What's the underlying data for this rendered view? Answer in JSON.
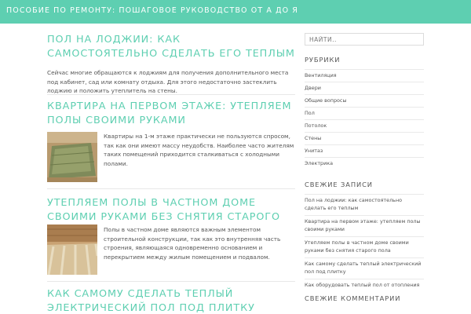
{
  "header": {
    "site_title": "Пособие по ремонту: пошаговое руководство от А до Я"
  },
  "posts": [
    {
      "title": "Пол на лоджии: как самостоятельно сделать его теплым",
      "excerpt": "Сейчас многие обращаются к лоджиям для получения дополнительного места под кабинет, сад или комнату отдыха. Для этого недостаточно застеклить лоджию и положить утеплитель на стены.",
      "has_thumbnail": false
    },
    {
      "title": "Квартира на первом этаже: утепляем полы своими руками",
      "excerpt": "Квартиры на 1-м этаже практически не пользуются спросом, так как они имеют массу неудобств. Наиболее часто жителям таких помещений приходится сталкиваться с холодными полами.",
      "has_thumbnail": true
    },
    {
      "title": "Утепляем полы в частном доме своими руками без снятия старого пола",
      "excerpt": "Полы в частном доме являются важным элементом строительной конструкции, так как это внутренняя часть строения, являющаяся одновременно основанием и перекрытием между жилым помещением и подвалом.",
      "has_thumbnail": true
    },
    {
      "title": "Как самому сделать теплый электрический пол под плитку",
      "excerpt": "",
      "has_thumbnail": false
    }
  ],
  "sidebar": {
    "search_placeholder": "Найти..",
    "categories_title": "Рубрики",
    "categories": [
      "Вентиляция",
      "Двери",
      "Общие вопросы",
      "Пол",
      "Потолок",
      "Стены",
      "Унитаз",
      "Электрика"
    ],
    "recent_posts_title": "Свежие записи",
    "recent_posts": [
      "Пол на лоджии: как самостоятельно сделать его теплым",
      "Квартира на первом этаже: утепляем полы своими руками",
      "Утепляем полы в частном доме своими руками без снятия старого пола",
      "Как самому сделать теплый электрический пол под плитку",
      "Как оборудовать теплый пол от отопления"
    ],
    "recent_comments_title": "Свежие комментарии"
  },
  "colors": {
    "accent": "#5ecfb1",
    "header_text": "#ffffff",
    "body_text": "#555555",
    "divider": "#e8e8e8"
  }
}
